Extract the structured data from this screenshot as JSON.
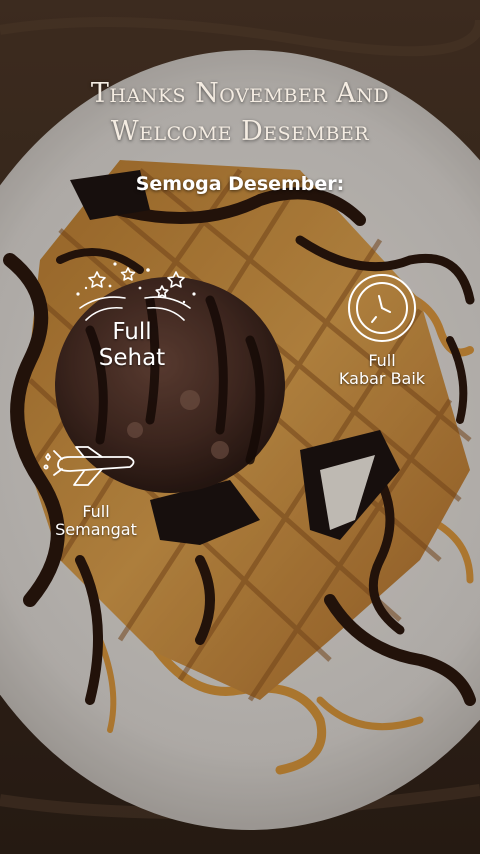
{
  "story": {
    "title_line_1": "Thanks November And",
    "title_line_2": "Welcome Desember",
    "subtitle": "Semoga Desember:",
    "wishes": [
      {
        "icon": "fireworks-icon",
        "line_1": "Full",
        "line_2": "Sehat"
      },
      {
        "icon": "clock-icon",
        "line_1": "Full",
        "line_2": "Kabar Baik"
      },
      {
        "icon": "airplane-icon",
        "line_1": "Full",
        "line_2": "Semangat"
      }
    ]
  },
  "colors": {
    "text": "#ffffff",
    "title_text": "#f4ece2",
    "plate": "#d9d4cf",
    "waffle": "#c98d3e",
    "chocolate": "#2a160d",
    "caramel": "#d08a2a",
    "ice_cream": "#4a2e25"
  }
}
